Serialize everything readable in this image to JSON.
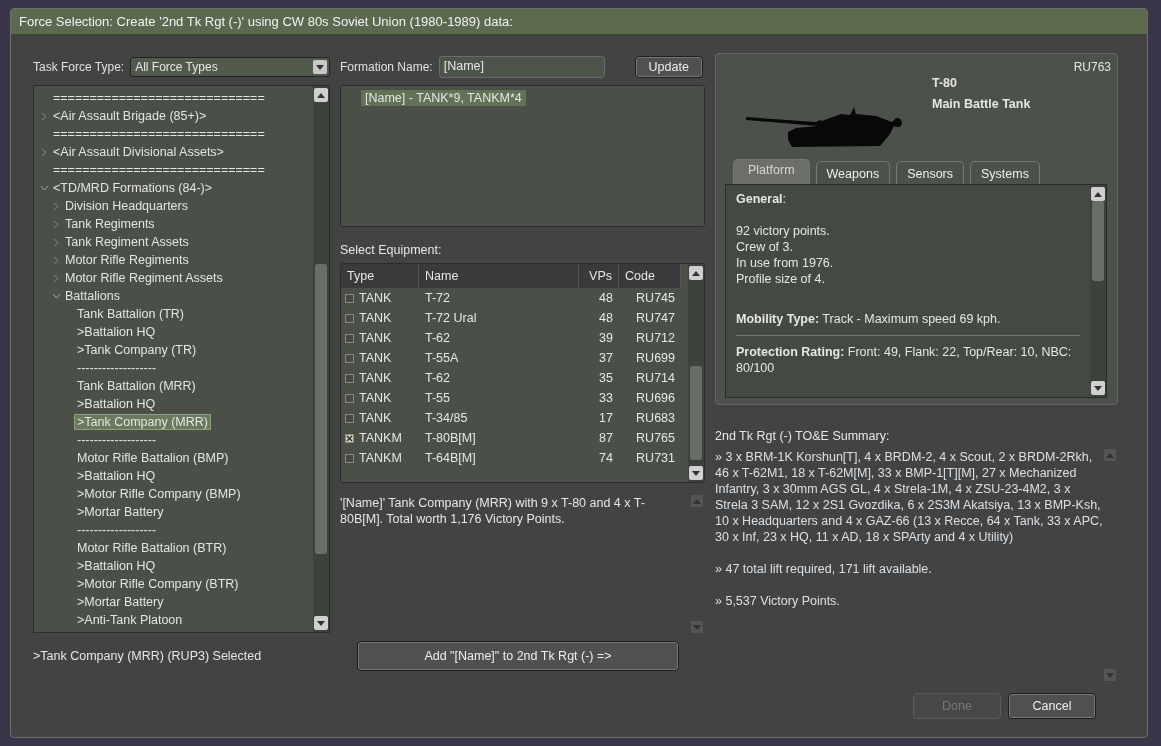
{
  "window": {
    "title": "Force Selection: Create '2nd Tk Rgt (-)' using CW 80s Soviet Union (1980-1989) data:"
  },
  "task_force": {
    "label": "Task Force Type:",
    "value": "All Force Types"
  },
  "tree": [
    {
      "label": "=============================",
      "selected": false
    },
    {
      "label": "<Air Assault Brigade (85+)>",
      "selected": false,
      "expanded": false
    },
    {
      "label": "=============================",
      "selected": false
    },
    {
      "label": "<Air Assault Divisional Assets>",
      "selected": false,
      "expanded": false
    },
    {
      "label": "=============================",
      "selected": false
    },
    {
      "label": "<TD/MRD Formations (84-)>",
      "selected": false,
      "expanded": true,
      "children": [
        {
          "label": "Division Headquarters",
          "selected": false,
          "expanded": false
        },
        {
          "label": "Tank Regiments",
          "selected": false,
          "expanded": false
        },
        {
          "label": "Tank Regiment Assets",
          "selected": false,
          "expanded": false
        },
        {
          "label": "Motor Rifle Regiments",
          "selected": false,
          "expanded": false
        },
        {
          "label": "Motor Rifle Regiment Assets",
          "selected": false,
          "expanded": false
        },
        {
          "label": "Battalions",
          "selected": false,
          "expanded": true,
          "children": [
            {
              "label": "Tank Battalion (TR)",
              "selected": false
            },
            {
              "label": ">Battalion HQ",
              "selected": false
            },
            {
              "label": ">Tank Company (TR)",
              "selected": false
            },
            {
              "label": "-------------------",
              "selected": false
            },
            {
              "label": "Tank Battalion (MRR)",
              "selected": false
            },
            {
              "label": ">Battalion HQ",
              "selected": false
            },
            {
              "label": ">Tank Company (MRR)",
              "selected": true
            },
            {
              "label": "-------------------",
              "selected": false
            },
            {
              "label": "Motor Rifle Battalion (BMP)",
              "selected": false
            },
            {
              "label": ">Battalion HQ",
              "selected": false
            },
            {
              "label": ">Motor Rifle Company (BMP)",
              "selected": false
            },
            {
              "label": ">Mortar Battery",
              "selected": false
            },
            {
              "label": "-------------------",
              "selected": false
            },
            {
              "label": "Motor Rifle Battalion (BTR)",
              "selected": false
            },
            {
              "label": ">Battalion HQ",
              "selected": false
            },
            {
              "label": ">Motor Rifle Company (BTR)",
              "selected": false
            },
            {
              "label": ">Mortar Battery",
              "selected": false
            },
            {
              "label": ">Anti-Tank Platoon",
              "selected": false
            }
          ]
        }
      ]
    }
  ],
  "status": ">Tank Company (MRR) (RUP3) Selected",
  "formation": {
    "label": "Formation Name:",
    "value": "[Name]",
    "update_button": "Update",
    "entry": "[Name]  -  TANK*9, TANKM*4"
  },
  "equipment": {
    "label": "Select Equipment:",
    "columns": [
      "Type",
      "Name",
      "VPs",
      "Code"
    ],
    "rows": [
      {
        "checked": false,
        "type": "TANK",
        "name": "T-72",
        "vps": "48",
        "code": "RU745"
      },
      {
        "checked": false,
        "type": "TANK",
        "name": "T-72 Ural",
        "vps": "48",
        "code": "RU747"
      },
      {
        "checked": false,
        "type": "TANK",
        "name": "T-62",
        "vps": "39",
        "code": "RU712"
      },
      {
        "checked": false,
        "type": "TANK",
        "name": "T-55A",
        "vps": "37",
        "code": "RU699"
      },
      {
        "checked": false,
        "type": "TANK",
        "name": "T-62",
        "vps": "35",
        "code": "RU714"
      },
      {
        "checked": false,
        "type": "TANK",
        "name": "T-55",
        "vps": "33",
        "code": "RU696"
      },
      {
        "checked": false,
        "type": "TANK",
        "name": "T-34/85",
        "vps": "17",
        "code": "RU683"
      },
      {
        "checked": true,
        "type": "TANKM",
        "name": "T-80B[M]",
        "vps": "87",
        "code": "RU765"
      },
      {
        "checked": false,
        "type": "TANKM",
        "name": "T-64B[M]",
        "vps": "74",
        "code": "RU731"
      }
    ]
  },
  "description": "'[Name]' Tank Company (MRR) with 9 x T-80 and 4 x T-80B[M].  Total worth 1,176 Victory Points.",
  "add_button": "Add \"[Name]\" to 2nd Tk Rgt (-)  =>",
  "unit": {
    "code": "RU763",
    "name": "T-80",
    "role": "Main Battle Tank",
    "tabs": [
      {
        "label": "Platform",
        "selected": true
      },
      {
        "label": "Weapons",
        "selected": false
      },
      {
        "label": "Sensors",
        "selected": false
      },
      {
        "label": "Systems",
        "selected": false
      }
    ],
    "sections": [
      {
        "lines": [
          "**General**:"
        ]
      },
      {
        "lines": [
          "92 victory points.",
          "Crew of 3.",
          "In use from 1976.",
          "Profile size of 4."
        ]
      },
      {
        "lines": [
          "**Mobility Type:** Track - Maximum speed 69 kph."
        ]
      },
      {
        "lines": [
          "**Protection Rating:** Front: 49, Flank: 22, Top/Rear: 10, NBC: 80/100"
        ]
      }
    ]
  },
  "summary": {
    "label": "2nd Tk Rgt (-) TO&E Summary:",
    "paragraphs": [
      "» 3 x BRM-1K Korshun[T], 4 x BRDM-2, 4 x Scout, 2 x BRDM-2Rkh, 46 x T-62M1, 18 x T-62M[M], 33 x BMP-1[T][M], 27 x Mechanized Infantry, 3 x 30mm AGS GL, 4 x Strela-1M, 4 x ZSU-23-4M2, 3 x Strela 3 SAM, 12 x 2S1 Gvozdika, 6 x 2S3M Akatsiya, 13 x BMP-Ksh, 10 x Headquarters and 4 x GAZ-66 (13 x Recce, 64 x Tank, 33 x APC, 30 x Inf, 23 x HQ, 11 x AD, 18 x SPArty and 4 x Utility)",
      "» 47 total lift required, 171 lift available.",
      "» 5,537 Victory Points."
    ]
  },
  "buttons": [
    {
      "label": "Done",
      "disabled": true
    },
    {
      "label": "Cancel",
      "disabled": false
    }
  ]
}
